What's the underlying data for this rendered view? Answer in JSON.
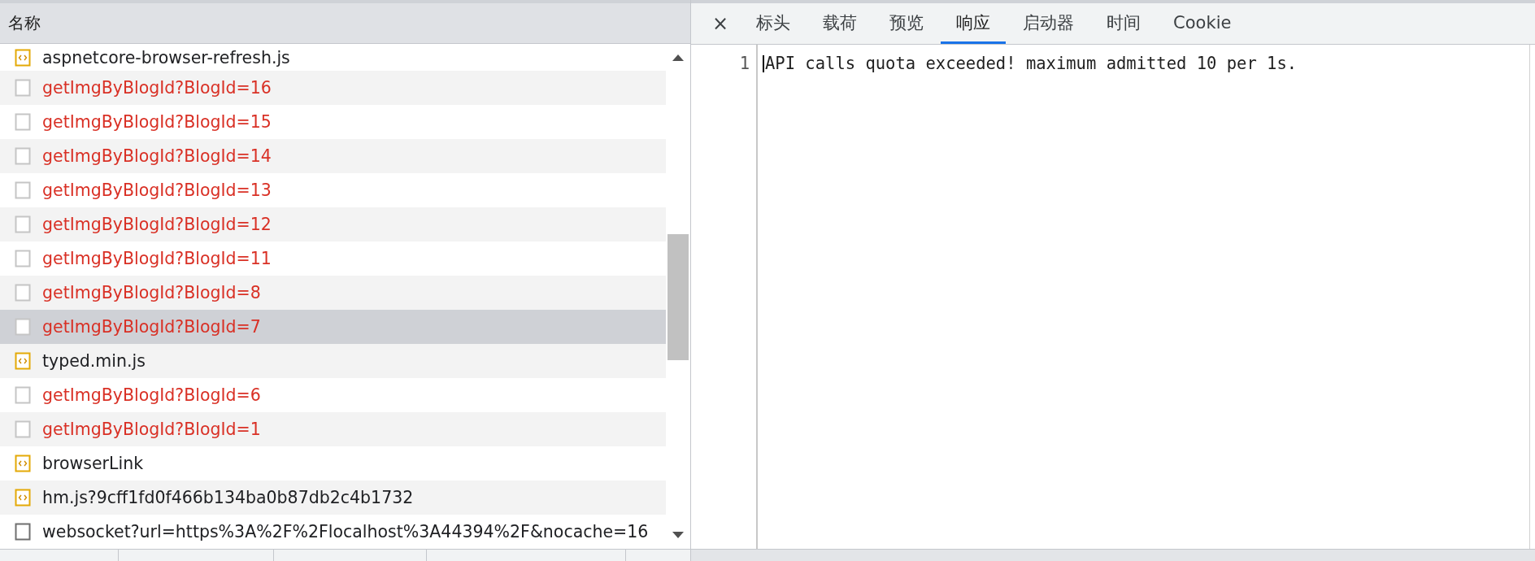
{
  "request_list": {
    "column_header": "名称",
    "rows": [
      {
        "name": "aspnetcore-browser-refresh.js",
        "kind": "script",
        "failed": false,
        "selected": false
      },
      {
        "name": "getImgByBlogId?BlogId=16",
        "kind": "document",
        "failed": true,
        "selected": false
      },
      {
        "name": "getImgByBlogId?BlogId=15",
        "kind": "document",
        "failed": true,
        "selected": false
      },
      {
        "name": "getImgByBlogId?BlogId=14",
        "kind": "document",
        "failed": true,
        "selected": false
      },
      {
        "name": "getImgByBlogId?BlogId=13",
        "kind": "document",
        "failed": true,
        "selected": false
      },
      {
        "name": "getImgByBlogId?BlogId=12",
        "kind": "document",
        "failed": true,
        "selected": false
      },
      {
        "name": "getImgByBlogId?BlogId=11",
        "kind": "document",
        "failed": true,
        "selected": false
      },
      {
        "name": "getImgByBlogId?BlogId=8",
        "kind": "document",
        "failed": true,
        "selected": false
      },
      {
        "name": "getImgByBlogId?BlogId=7",
        "kind": "document",
        "failed": true,
        "selected": true
      },
      {
        "name": "typed.min.js",
        "kind": "script",
        "failed": false,
        "selected": false
      },
      {
        "name": "getImgByBlogId?BlogId=6",
        "kind": "document",
        "failed": true,
        "selected": false
      },
      {
        "name": "getImgByBlogId?BlogId=1",
        "kind": "document",
        "failed": true,
        "selected": false
      },
      {
        "name": "browserLink",
        "kind": "script",
        "failed": false,
        "selected": false
      },
      {
        "name": "hm.js?9cff1fd0f466b134ba0b87db2c4b1732",
        "kind": "script",
        "failed": false,
        "selected": false
      },
      {
        "name": "websocket?url=https%3A%2F%2Flocalhost%3A44394%2F&nocache=16",
        "kind": "document",
        "failed": false,
        "selected": false
      }
    ]
  },
  "detail_panel": {
    "close_label": "×",
    "tabs": [
      {
        "label": "标头",
        "selected": false
      },
      {
        "label": "载荷",
        "selected": false
      },
      {
        "label": "预览",
        "selected": false
      },
      {
        "label": "响应",
        "selected": true
      },
      {
        "label": "启动器",
        "selected": false
      },
      {
        "label": "时间",
        "selected": false
      },
      {
        "label": "Cookie",
        "selected": false
      }
    ],
    "response": {
      "lines": [
        {
          "number": "1",
          "text": "API calls quota exceeded! maximum admitted 10 per 1s."
        }
      ]
    }
  }
}
